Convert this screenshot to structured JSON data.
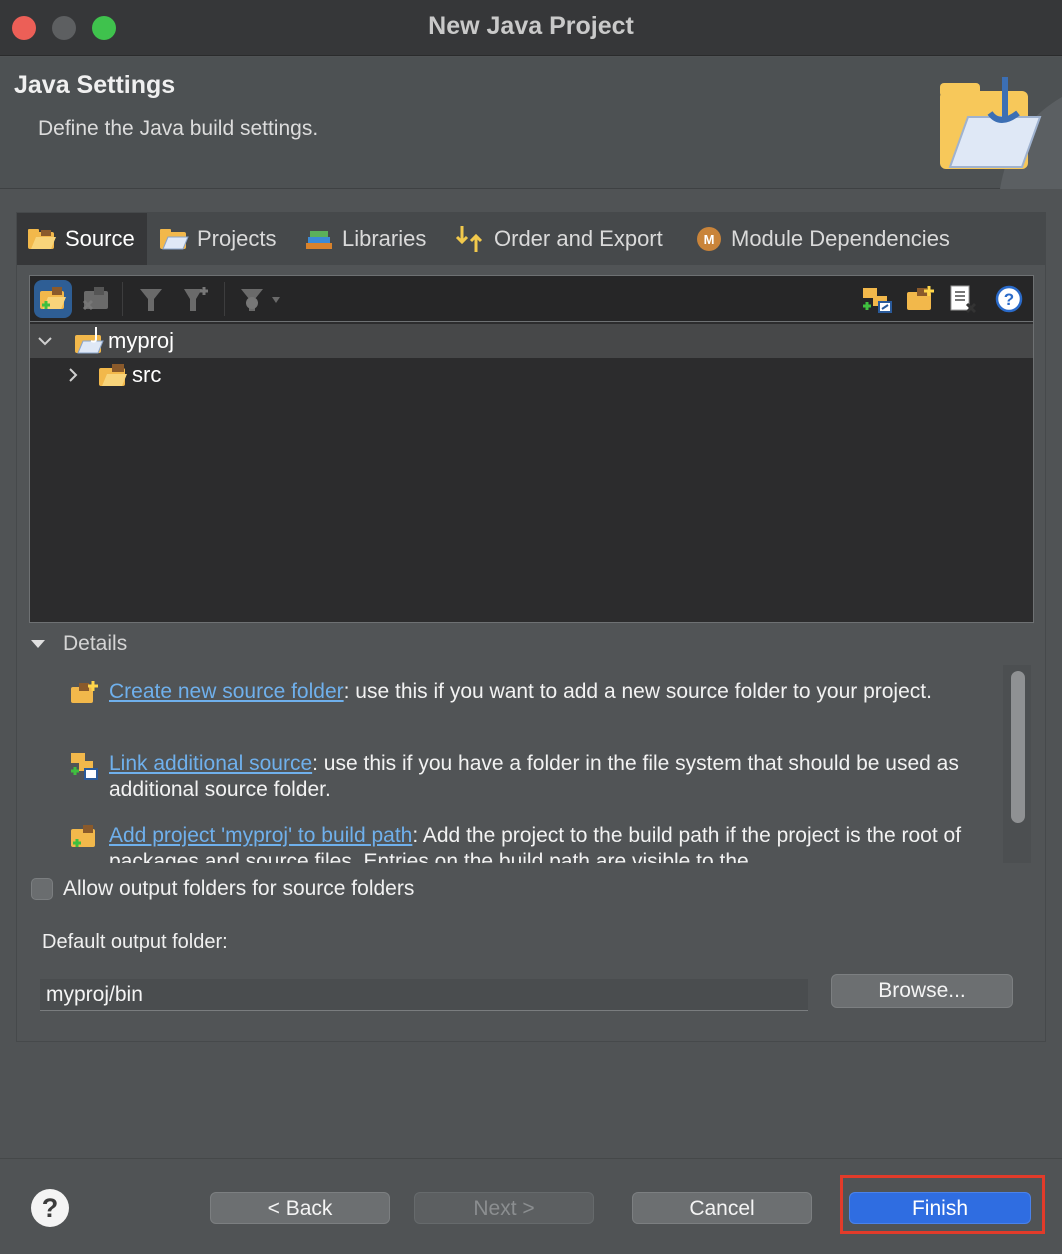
{
  "window": {
    "title": "New Java Project"
  },
  "header": {
    "title": "Java Settings",
    "description": "Define the Java build settings."
  },
  "tabs": [
    {
      "label": "Source",
      "icon": "source-folder-icon",
      "active": true
    },
    {
      "label": "Projects",
      "icon": "projects-icon",
      "active": false
    },
    {
      "label": "Libraries",
      "icon": "libraries-icon",
      "active": false
    },
    {
      "label": "Order and Export",
      "icon": "order-export-icon",
      "active": false
    },
    {
      "label": "Module Dependencies",
      "icon": "module-icon",
      "active": false
    }
  ],
  "tree": {
    "rows": [
      {
        "label": "myproj",
        "expanded": true,
        "icon": "java-project-icon"
      },
      {
        "label": "src",
        "expanded": false,
        "icon": "package-folder-icon"
      }
    ]
  },
  "details": {
    "label": "Details",
    "items": [
      {
        "link": "Create new source folder",
        "text": ": use this if you want to add a new source folder to your project."
      },
      {
        "link": "Link additional source",
        "text": ": use this if you have a folder in the file system that should be used as additional source folder."
      },
      {
        "link": "Add project 'myproj' to build path",
        "text": ": Add the project to the build path if the project is the root of packages and source files. Entries on the build path are visible to the"
      }
    ]
  },
  "options": {
    "allow_output_folders_label": "Allow output folders for source folders",
    "allow_output_folders_checked": false,
    "default_output_label": "Default output folder:",
    "default_output_value": "myproj/bin",
    "browse_label": "Browse..."
  },
  "footer": {
    "help_label": "?",
    "back_label": "< Back",
    "next_label": "Next >",
    "cancel_label": "Cancel",
    "finish_label": "Finish"
  },
  "colors": {
    "accent": "#2f6de1",
    "link": "#6fb0ec",
    "highlight": "#e23b2a"
  }
}
